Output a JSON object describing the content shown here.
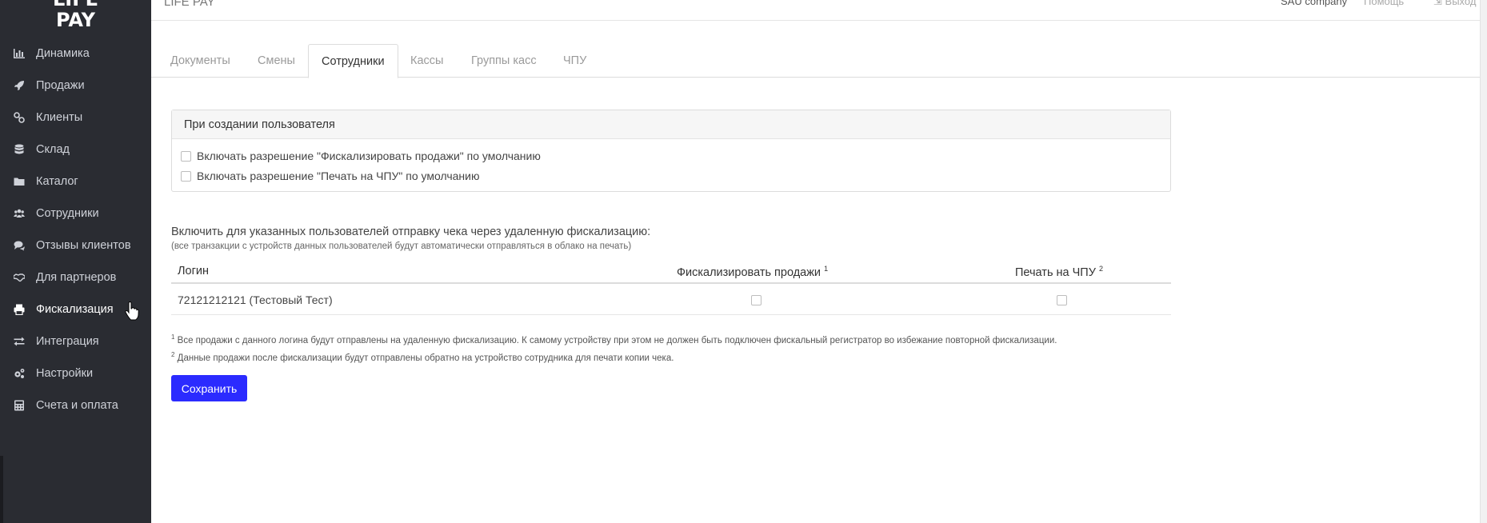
{
  "app": {
    "logo_line1": "LIFE",
    "logo_line2": "PAY",
    "brand_text": "LIFE PAY",
    "company": "SAU company",
    "help": "Помощь",
    "logout": "Выход"
  },
  "sidebar": {
    "items": [
      {
        "label": "Динамика",
        "icon": "bar-chart-icon"
      },
      {
        "label": "Продажи",
        "icon": "rocket-icon"
      },
      {
        "label": "Клиенты",
        "icon": "link-icon"
      },
      {
        "label": "Склад",
        "icon": "database-icon"
      },
      {
        "label": "Каталог",
        "icon": "folder-icon"
      },
      {
        "label": "Сотрудники",
        "icon": "users-icon"
      },
      {
        "label": "Отзывы клиентов",
        "icon": "comments-icon"
      },
      {
        "label": "Для партнеров",
        "icon": "handshake-icon"
      },
      {
        "label": "Фискализация",
        "icon": "print-icon",
        "active": true
      },
      {
        "label": "Интеграция",
        "icon": "exchange-icon"
      },
      {
        "label": "Настройки",
        "icon": "cogs-icon"
      },
      {
        "label": "Счета и оплата",
        "icon": "calculator-icon"
      }
    ]
  },
  "tabs": [
    {
      "label": "Документы"
    },
    {
      "label": "Смены"
    },
    {
      "label": "Сотрудники",
      "active": true
    },
    {
      "label": "Кассы"
    },
    {
      "label": "Группы касс"
    },
    {
      "label": "ЧПУ"
    }
  ],
  "panel": {
    "title": "При создании пользователя",
    "options": [
      {
        "label": "Включать разрешение \"Фискализировать продажи\" по умолчанию",
        "checked": false
      },
      {
        "label": "Включать разрешение \"Печать на ЧПУ\" по умолчанию",
        "checked": false
      }
    ]
  },
  "remote": {
    "title": "Включить для указанных пользователей отправку чека через удаленную фискализацию:",
    "subtitle": "(все транзакции с устройств данных пользователей будут автоматически отправляться в облако на печать)",
    "columns": {
      "login": "Логин",
      "fiscalize": "Фискализировать продажи",
      "fiscalize_sup": "1",
      "print": "Печать на ЧПУ",
      "print_sup": "2"
    },
    "rows": [
      {
        "login": "72121212121 (Тестовый Тест)",
        "fiscalize": false,
        "print": false
      }
    ]
  },
  "footnotes": {
    "n1": "1",
    "t1": "Все продажи с данного логина будут отправлены на удаленную фискализацию. К самому устройству при этом не должен быть подключен фискальный регистратор во избежание повторной фискализации.",
    "n2": "2",
    "t2": "Данные продажи после фискализации будут отправлены обратно на устройство сотрудника для печати копии чека."
  },
  "actions": {
    "save": "Сохранить"
  },
  "colors": {
    "sidebar_bg": "#2a2c32",
    "primary": "#2b2bff"
  }
}
